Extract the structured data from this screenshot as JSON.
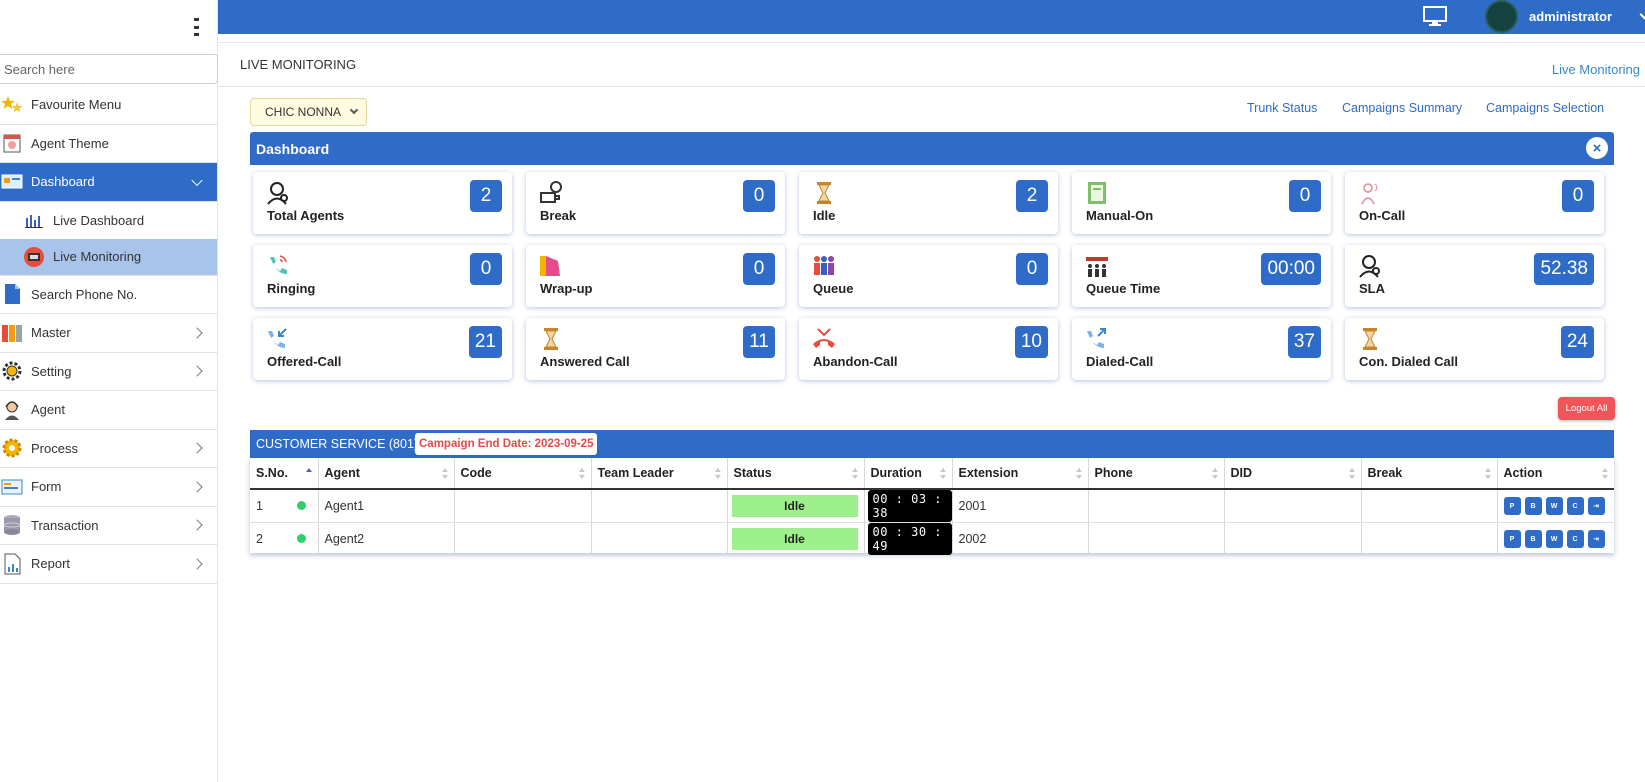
{
  "sidebar": {
    "search_placeholder": "Search here",
    "items": [
      {
        "label": "Favourite Menu",
        "icon": "star-icon"
      },
      {
        "label": "Agent Theme",
        "icon": "theme-icon"
      },
      {
        "label": "Dashboard",
        "icon": "dashboard-icon"
      },
      {
        "label": "Live Dashboard",
        "icon": "bar-chart-icon"
      },
      {
        "label": "Live Monitoring",
        "icon": "monitor-icon"
      },
      {
        "label": "Search Phone No.",
        "icon": "document-icon"
      },
      {
        "label": "Master",
        "icon": "folders-icon"
      },
      {
        "label": "Setting",
        "icon": "gear-icon"
      },
      {
        "label": "Agent",
        "icon": "agent-icon"
      },
      {
        "label": "Process",
        "icon": "cogs-icon"
      },
      {
        "label": "Form",
        "icon": "form-icon"
      },
      {
        "label": "Transaction",
        "icon": "database-icon"
      },
      {
        "label": "Report",
        "icon": "report-icon"
      }
    ]
  },
  "header": {
    "user": "administrator",
    "page_title": "LIVE MONITORING",
    "breadcrumb": "Live Monitoring"
  },
  "toolbar": {
    "campaign": "CHIC NONNA",
    "links": [
      "Trunk Status",
      "Campaigns Summary",
      "Campaigns Selection"
    ]
  },
  "dashboard": {
    "title": "Dashboard",
    "close_glyph": "×",
    "cards": [
      {
        "label": "Total Agents",
        "value": "2",
        "icon": "agent-headset-icon"
      },
      {
        "label": "Break",
        "value": "0",
        "icon": "coffee-icon"
      },
      {
        "label": "Idle",
        "value": "2",
        "icon": "hourglass-icon"
      },
      {
        "label": "Manual-On",
        "value": "0",
        "icon": "notebook-icon"
      },
      {
        "label": "On-Call",
        "value": "0",
        "icon": "on-call-icon"
      },
      {
        "label": "Ringing",
        "value": "0",
        "icon": "phone-ringing-icon"
      },
      {
        "label": "Wrap-up",
        "value": "0",
        "icon": "wrap-up-icon"
      },
      {
        "label": "Queue",
        "value": "0",
        "icon": "queue-people-icon"
      },
      {
        "label": "Queue Time",
        "value": "00:00",
        "icon": "queue-time-icon"
      },
      {
        "label": "SLA",
        "value": "52.38",
        "icon": "sla-icon"
      },
      {
        "label": "Offered-Call",
        "value": "21",
        "icon": "incoming-call-icon"
      },
      {
        "label": "Answered Call",
        "value": "11",
        "icon": "hourglass-icon"
      },
      {
        "label": "Abandon-Call",
        "value": "10",
        "icon": "missed-call-icon"
      },
      {
        "label": "Dialed-Call",
        "value": "37",
        "icon": "outgoing-call-icon"
      },
      {
        "label": "Con. Dialed Call",
        "value": "24",
        "icon": "hourglass-icon"
      }
    ]
  },
  "logout_all": "Logout All",
  "campaign_table": {
    "title": "CUSTOMER SERVICE (801) -",
    "end_date": "Campaign End Date: 2023-09-25",
    "columns": [
      "S.No.",
      "Agent",
      "Code",
      "Team Leader",
      "Status",
      "Duration",
      "Extension",
      "Phone",
      "DID",
      "Break",
      "Action"
    ],
    "rows": [
      {
        "sno": "1",
        "agent": "Agent1",
        "code": "",
        "team_leader": "",
        "status": "Idle",
        "duration": "00 : 03 : 38",
        "extension": "2001",
        "phone": "",
        "did": "",
        "break": ""
      },
      {
        "sno": "2",
        "agent": "Agent2",
        "code": "",
        "team_leader": "",
        "status": "Idle",
        "duration": "00 : 30 : 49",
        "extension": "2002",
        "phone": "",
        "did": "",
        "break": ""
      }
    ],
    "actions": [
      "P",
      "B",
      "W",
      "C",
      "⇥"
    ]
  },
  "colors": {
    "primary": "#2f6cc7",
    "idle": "#9ef08d",
    "danger": "#f0555a",
    "online": "#2fcf6a"
  }
}
